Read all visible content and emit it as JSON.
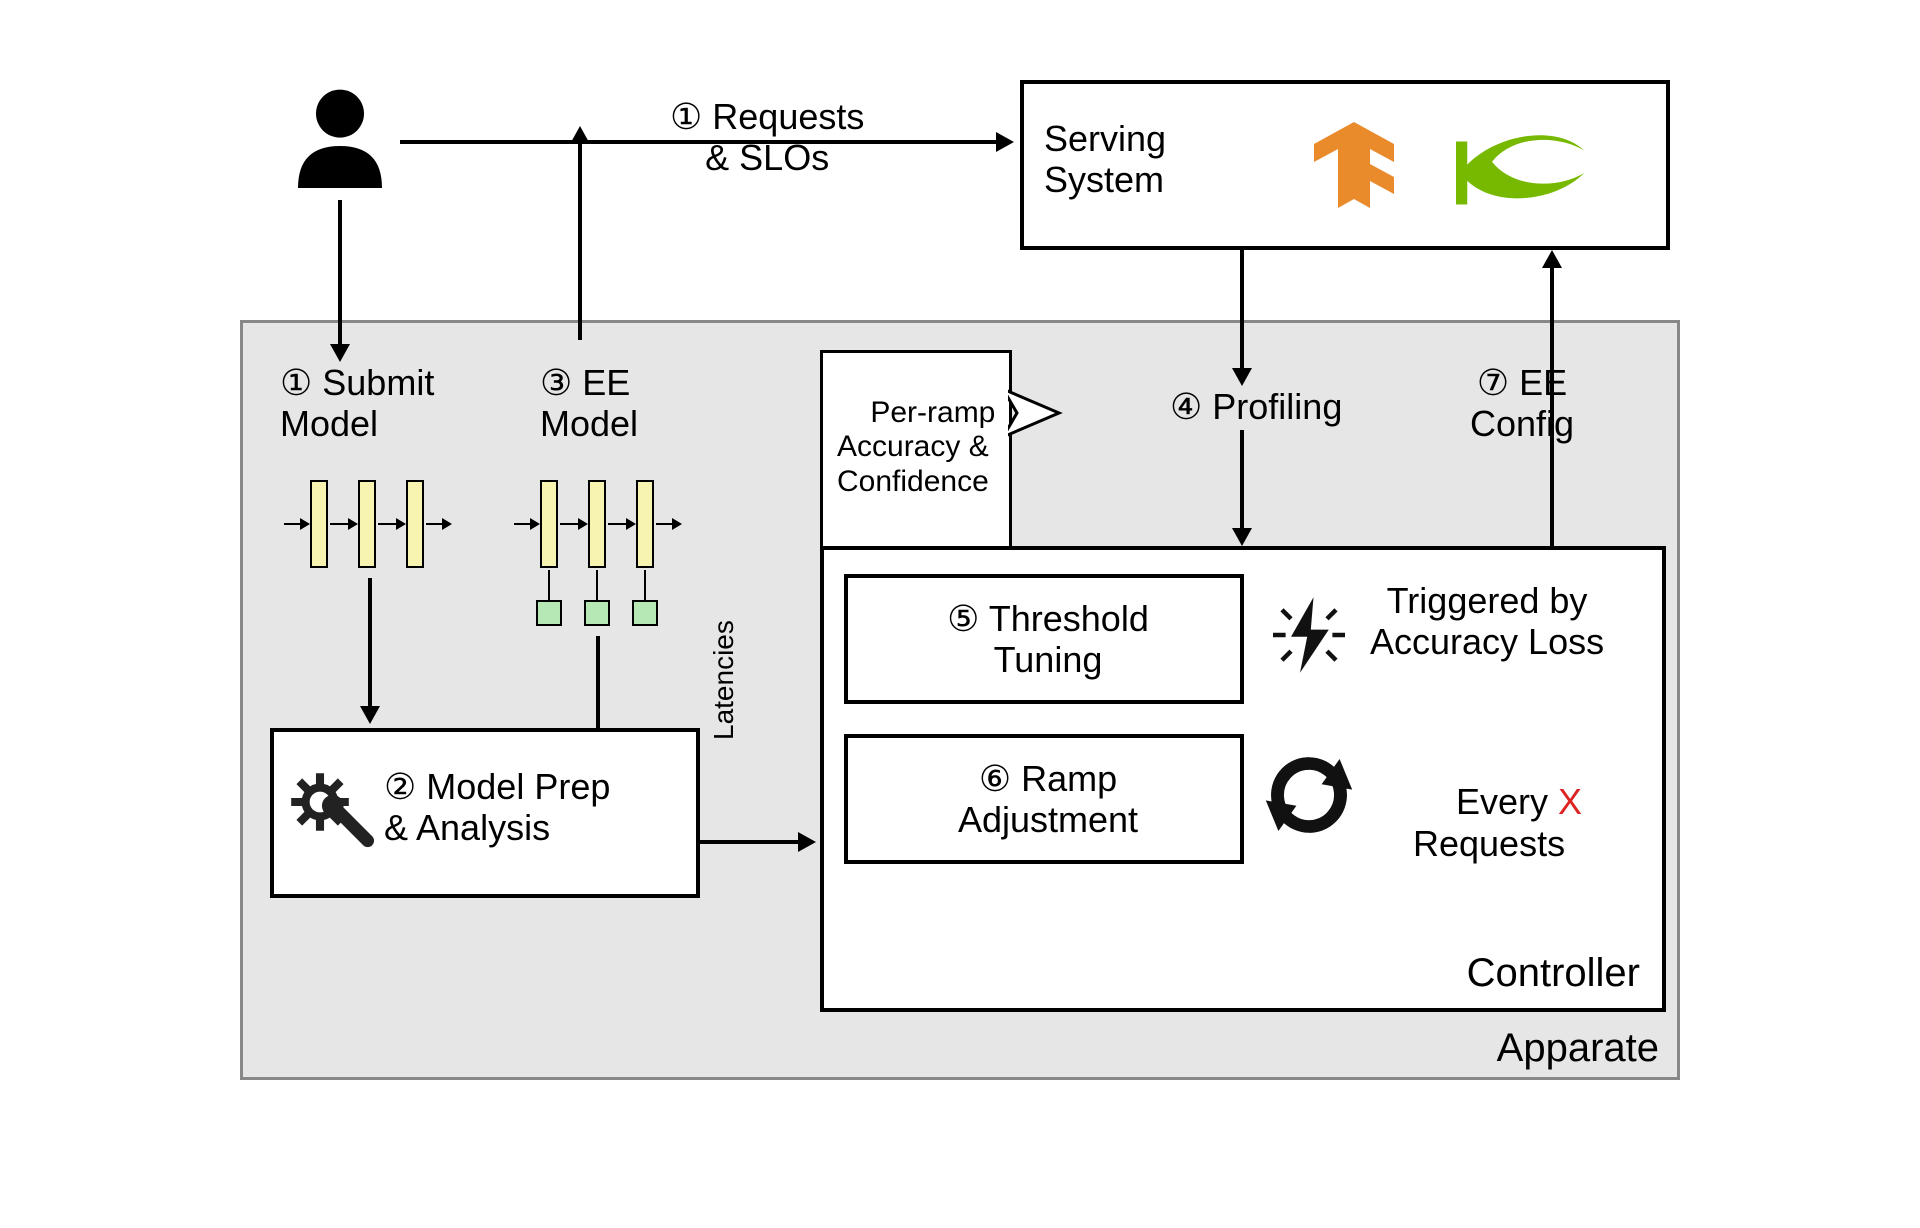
{
  "top": {
    "requests_slos": "① Requests\n& SLOs",
    "serving_system": "Serving\nSystem"
  },
  "apparate_label": "Apparate",
  "steps": {
    "submit_model": "① Submit\nModel",
    "ee_model": "③ EE\nModel",
    "profiling": "④ Profiling",
    "ee_config": "⑦ EE\nConfig",
    "model_prep": "② Model Prep\n& Analysis",
    "threshold_tuning": "⑤ Threshold\nTuning",
    "ramp_adjustment": "⑥ Ramp\nAdjustment"
  },
  "bubble": {
    "text": "Per-ramp\nAccuracy &\nConfidence"
  },
  "controller": {
    "label": "Controller",
    "triggered_by": "Triggered by\nAccuracy Loss",
    "every_requests_pre": "Every ",
    "every_requests_x": "X",
    "every_requests_post": "\nRequests"
  },
  "edge_labels": {
    "latencies": "Latencies"
  },
  "icons": {
    "user": "user-icon",
    "gear": "gear-wrench-icon",
    "flash": "flash-icon",
    "refresh": "refresh-icon",
    "tensorflow": "tensorflow-icon",
    "nvidia": "nvidia-icon"
  }
}
